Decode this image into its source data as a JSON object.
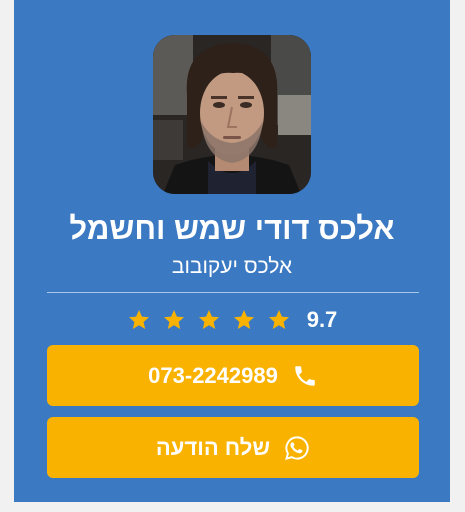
{
  "profile": {
    "business_name": "אלכס דודי שמש וחשמל",
    "owner_name": "אלכס יעקובוב"
  },
  "rating": {
    "score": "9.7",
    "stars": 5
  },
  "buttons": {
    "call_label": "073-2242989",
    "message_label": "שלח הודעה"
  },
  "icons": {
    "call": "phone-icon",
    "message": "whatsapp-icon",
    "star": "star-icon"
  },
  "colors": {
    "card_background": "#3b7ac2",
    "button_background": "#f9b200",
    "star": "#f9b200",
    "text": "#ffffff"
  }
}
